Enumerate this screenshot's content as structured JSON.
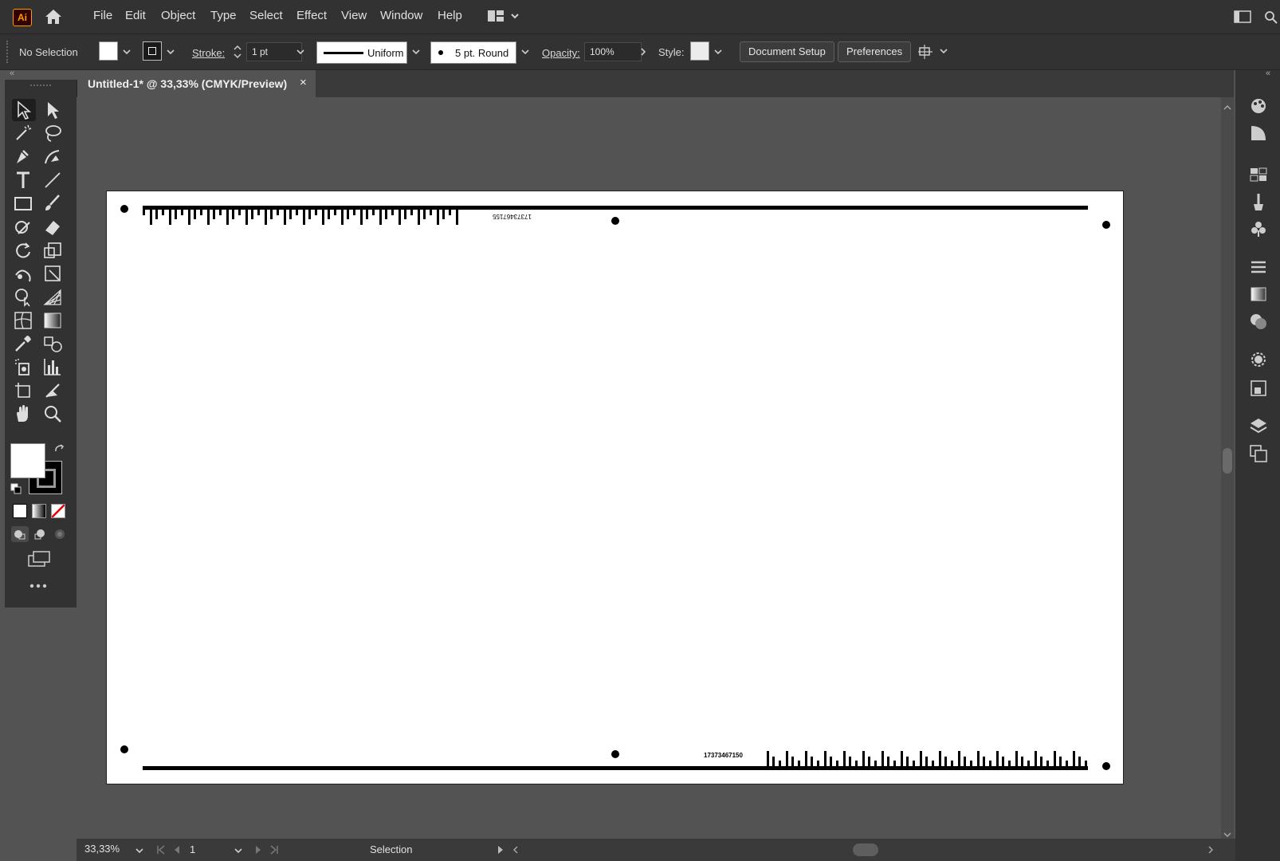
{
  "app": {
    "logo_text": "Ai"
  },
  "menu": {
    "items": [
      "File",
      "Edit",
      "Object",
      "Type",
      "Select",
      "Effect",
      "View",
      "Window",
      "Help"
    ]
  },
  "controlbar": {
    "selection_status": "No Selection",
    "stroke_label": "Stroke:",
    "stroke_weight": "1 pt",
    "variable_width_profile": "Uniform",
    "brush_definition": "5 pt. Round",
    "opacity_label": "Opacity:",
    "opacity_value": "100%",
    "style_label": "Style:",
    "document_setup_label": "Document Setup",
    "preferences_label": "Preferences"
  },
  "document": {
    "tab_title": "Untitled-1* @ 33,33% (CMYK/Preview)",
    "close_glyph": "×"
  },
  "artboard": {
    "top_barcode_number": "17373467155",
    "bottom_barcode_number": "17373467150"
  },
  "statusbar": {
    "zoom": "33,33%",
    "artboard_number": "1",
    "current_tool": "Selection"
  },
  "colors": {
    "ui_dark": "#323232",
    "canvas": "#535353",
    "accent_logo": "#ff9a00"
  },
  "icons": {
    "left_tools": [
      "selection-tool",
      "direct-selection-tool",
      "magic-wand-tool",
      "lasso-tool",
      "pen-tool",
      "curvature-tool",
      "type-tool",
      "line-segment-tool",
      "rectangle-tool",
      "paintbrush-tool",
      "shaper-tool",
      "eraser-tool",
      "rotate-tool",
      "scale-tool",
      "warp-tool",
      "free-transform-tool",
      "shape-builder-tool",
      "perspective-grid-tool",
      "mesh-tool",
      "gradient-tool",
      "eyedropper-tool",
      "blend-tool",
      "symbol-sprayer-tool",
      "column-graph-tool",
      "artboard-tool",
      "slice-tool",
      "hand-tool",
      "zoom-tool"
    ],
    "right_panels": [
      "color-panel",
      "color-guide-panel",
      "swatches-panel",
      "brushes-panel",
      "symbols-panel",
      "stroke-panel",
      "gradient-panel",
      "transparency-panel",
      "appearance-panel",
      "asset-export-panel",
      "layers-panel",
      "artboards-panel"
    ]
  }
}
